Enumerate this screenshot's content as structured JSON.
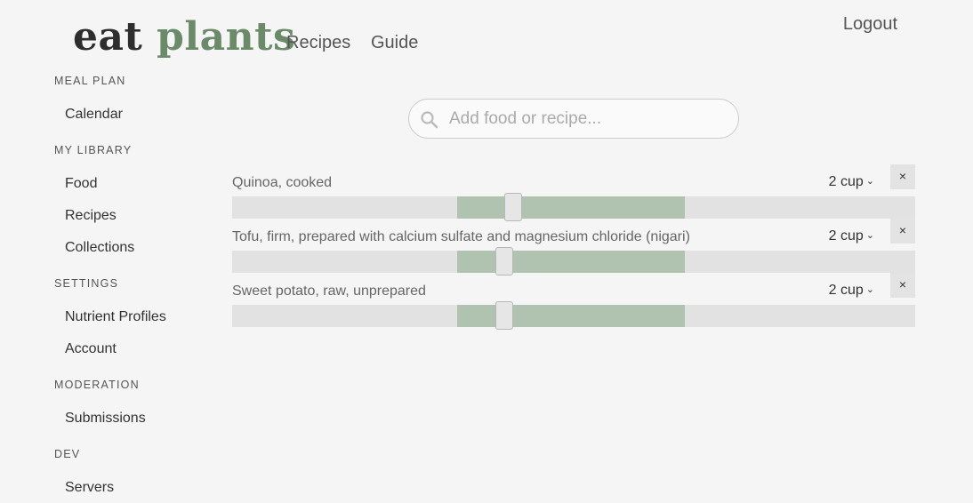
{
  "header": {
    "logo_word1": "eat",
    "logo_word2": "plants",
    "nav": [
      {
        "label": "Recipes"
      },
      {
        "label": "Guide"
      }
    ],
    "logout_label": "Logout"
  },
  "sidebar": {
    "sections": [
      {
        "title": "MEAL PLAN",
        "items": [
          {
            "label": "Calendar"
          }
        ]
      },
      {
        "title": "MY LIBRARY",
        "items": [
          {
            "label": "Food"
          },
          {
            "label": "Recipes"
          },
          {
            "label": "Collections"
          }
        ]
      },
      {
        "title": "SETTINGS",
        "items": [
          {
            "label": "Nutrient Profiles"
          },
          {
            "label": "Account"
          }
        ]
      },
      {
        "title": "MODERATION",
        "items": [
          {
            "label": "Submissions"
          }
        ]
      },
      {
        "title": "DEV",
        "items": [
          {
            "label": "Servers"
          }
        ]
      }
    ]
  },
  "search": {
    "placeholder": "Add food or recipe...",
    "value": "",
    "icon": "search-icon"
  },
  "foods": [
    {
      "name": "Quinoa, cooked",
      "quantity": "2 cup",
      "remove_label": "×",
      "range_low": 0.33,
      "range_high": 0.663,
      "thumb": 0.411
    },
    {
      "name": "Tofu, firm, prepared with calcium sulfate and magnesium chloride (nigari)",
      "quantity": "2 cup",
      "remove_label": "×",
      "range_low": 0.33,
      "range_high": 0.663,
      "thumb": 0.398
    },
    {
      "name": "Sweet potato, raw, unprepared",
      "quantity": "2 cup",
      "remove_label": "×",
      "range_low": 0.33,
      "range_high": 0.663,
      "thumb": 0.398
    }
  ],
  "colors": {
    "logo_dark": "#2e2e2e",
    "logo_green": "#6a8a6a",
    "range_fill": "#b0c3b0",
    "track": "#e2e2e2",
    "background": "#f5f5f5"
  }
}
